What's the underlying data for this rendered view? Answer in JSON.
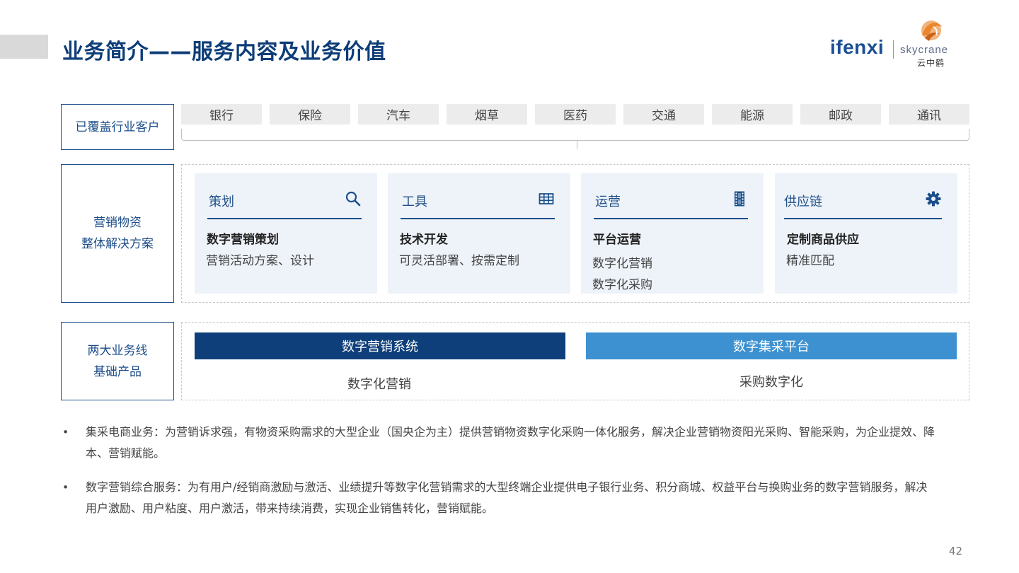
{
  "header": {
    "title": "业务简介——服务内容及业务价值",
    "logo": {
      "ifenxi": "ifenxi",
      "skycrane": "skycrane",
      "skycrane_cn": "云中鹤"
    }
  },
  "rows": {
    "industries_label": "已覆盖行业客户",
    "solutions_label": [
      "营销物资",
      "整体解决方案"
    ],
    "products_label": [
      "两大业务线",
      "基础产品"
    ]
  },
  "industries": [
    "银行",
    "保险",
    "汽车",
    "烟草",
    "医药",
    "交通",
    "能源",
    "邮政",
    "通讯"
  ],
  "cards": [
    {
      "title": "策划",
      "icon": "search-icon",
      "heading": "数字营销策划",
      "lines": [
        "营销活动方案、设计"
      ]
    },
    {
      "title": "工具",
      "icon": "table-icon",
      "heading": "技术开发",
      "lines": [
        "可灵活部署、按需定制"
      ]
    },
    {
      "title": "运营",
      "icon": "film-icon",
      "heading": "平台运营",
      "lines": [
        "数字化营销",
        "数字化采购"
      ]
    },
    {
      "title": "供应链",
      "icon": "gear-icon",
      "heading": "定制商品供应",
      "lines": [
        "精准匹配"
      ]
    }
  ],
  "products": [
    {
      "name": "数字营销系统",
      "caption": "数字化营销",
      "color": "#0e3f7a"
    },
    {
      "name": "数字集采平台",
      "caption": "采购数字化",
      "color": "#3d91d0"
    }
  ],
  "bullets": [
    {
      "marker": "•",
      "lines": [
        "集采电商业务：为营销诉求强，有物资采购需求的大型企业（国央企为主）提供营销物资数字化采购一体化服务，解决企业营销物资阳光采购、智能采购，为企业提效、降",
        "本、营销赋能。"
      ]
    },
    {
      "marker": "•",
      "lines": [
        "数字营销综合服务：为有用户/经销商激励与激活、业绩提升等数字化营销需求的大型终端企业提供电子银行业务、积分商城、权益平台与换购业务的数字营销服务，解决",
        "用户激励、用户粘度、用户激活，带来持续消费，实现企业销售转化，营销赋能。"
      ]
    }
  ],
  "page_number": "42",
  "colors": {
    "title": "#0d3d78",
    "accent_dark": "#0e3f7a",
    "accent_light": "#3d91d0",
    "card_bg": "#eef3fa",
    "logo_orange": "#e9862d"
  }
}
